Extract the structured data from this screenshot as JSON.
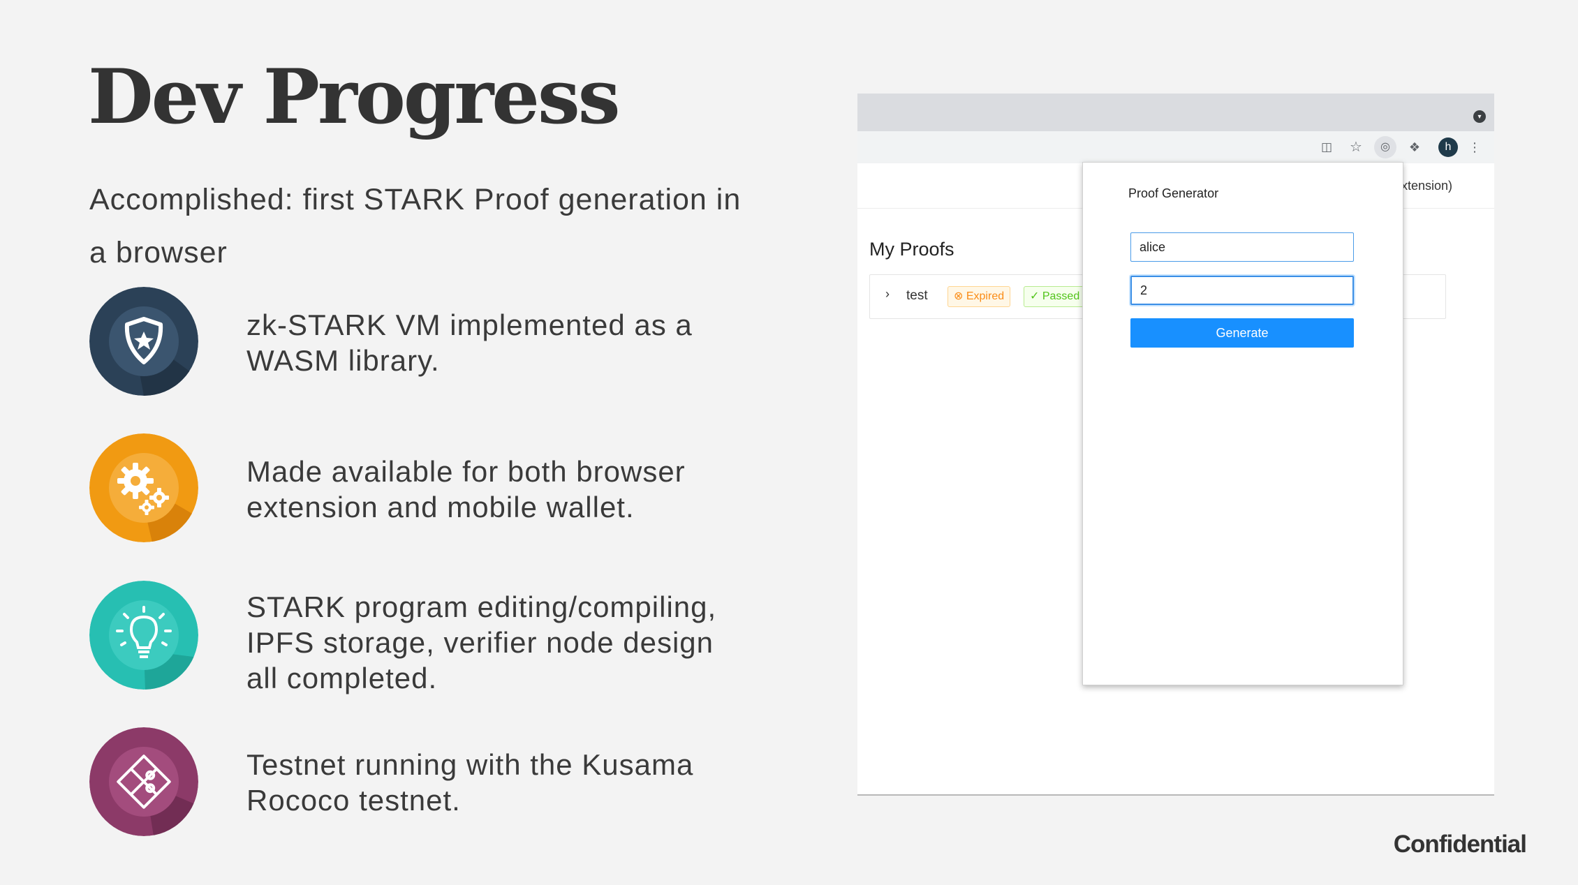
{
  "slide": {
    "title": "Dev Progress",
    "subtitle": "Accomplished: first STARK Proof generation in a browser",
    "features": [
      {
        "text": "zk-STARK VM implemented as a WASM library.",
        "icon": "shield-star-icon",
        "color": "#2b4157"
      },
      {
        "text": "Made available for both browser extension and mobile wallet.",
        "icon": "gears-icon",
        "color": "#f19a12"
      },
      {
        "text": "STARK program editing/compiling, IPFS storage, verifier node design all completed.",
        "icon": "lightbulb-icon",
        "color": "#27bfb2"
      },
      {
        "text": "Testnet running with the Kusama Rococo testnet.",
        "icon": "puzzle-icon",
        "color": "#8c3a68"
      }
    ],
    "footer": "Confidential"
  },
  "browser": {
    "toolbar_icons": [
      "translate-icon",
      "star-icon",
      "extension-active-icon",
      "puzzle-extensions-icon",
      "more-icon"
    ],
    "avatar": "h",
    "extension_text": "xtension)",
    "proofs_heading": "My Proofs",
    "proofs": [
      {
        "name": "test",
        "tags": [
          "Expired",
          "Passed"
        ]
      }
    ],
    "popup": {
      "title": "Proof Generator",
      "name_value": "alice",
      "number_value": "2",
      "button_label": "Generate"
    }
  },
  "colors": {
    "background": "#f3f3f3",
    "accent_blue": "#1890ff",
    "expired": "#fa8c16",
    "passed": "#52c41a"
  }
}
